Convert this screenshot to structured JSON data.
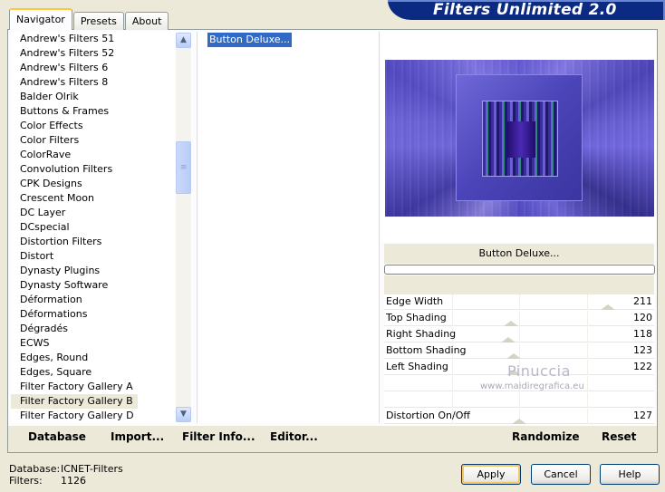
{
  "banner": {
    "title": "Filters Unlimited 2.0"
  },
  "tabs": [
    {
      "label": "Navigator",
      "active": true
    },
    {
      "label": "Presets",
      "active": false
    },
    {
      "label": "About",
      "active": false
    }
  ],
  "categories": [
    "Andrew's Filters 51",
    "Andrew's Filters 52",
    "Andrew's Filters 6",
    "Andrew's Filters 8",
    "Balder Olrik",
    "Buttons & Frames",
    "Color Effects",
    "Color Filters",
    "ColorRave",
    "Convolution Filters",
    "CPK Designs",
    "Crescent Moon",
    "DC Layer",
    "DCspecial",
    "Distortion Filters",
    "Distort",
    "Dynasty Plugins",
    "Dynasty Software",
    "Déformation",
    "Déformations",
    "Dégradés",
    "ECWS",
    "Edges, Round",
    "Edges, Square",
    "Filter Factory Gallery A",
    "Filter Factory Gallery B",
    "Filter Factory Gallery D"
  ],
  "selected_category": "Filter Factory Gallery B",
  "filters": [
    "Button Deluxe..."
  ],
  "selected_filter": "Button Deluxe...",
  "filter_name_label": "Button Deluxe...",
  "progress": 0,
  "params": [
    {
      "name": "Edge Width",
      "value": "211",
      "level": 0.83
    },
    {
      "name": "Top Shading",
      "value": "120",
      "level": 0.47
    },
    {
      "name": "Right Shading",
      "value": "118",
      "level": 0.46
    },
    {
      "name": "Bottom Shading",
      "value": "123",
      "level": 0.48
    },
    {
      "name": "Left Shading",
      "value": "122",
      "level": 0.48
    },
    {
      "name": "",
      "value": "",
      "level": null
    },
    {
      "name": "",
      "value": "",
      "level": null
    },
    {
      "name": "Distortion On/Off",
      "value": "127",
      "level": 0.5
    }
  ],
  "toolbar": {
    "database": "Database",
    "import": "Import...",
    "filter_info": "Filter Info...",
    "editor": "Editor...",
    "randomize": "Randomize",
    "reset": "Reset"
  },
  "status": {
    "database_label": "Database:",
    "database_value": "ICNET-Filters",
    "filters_label": "Filters:",
    "filters_value": "1126"
  },
  "buttons": {
    "apply": "Apply",
    "cancel": "Cancel",
    "help": "Help"
  },
  "watermark": {
    "line1": "Pinuccia",
    "line2": "www.maidiregrafica.eu"
  }
}
